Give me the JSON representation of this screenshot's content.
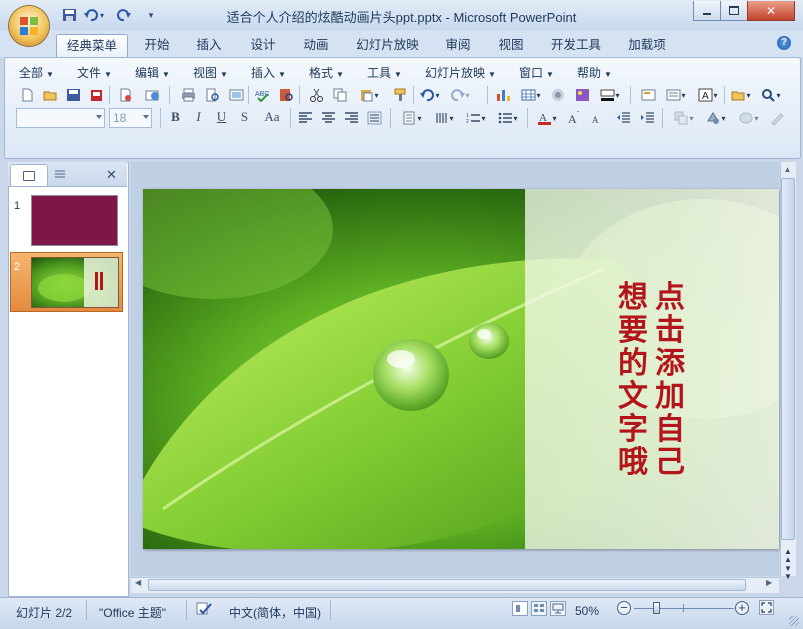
{
  "window": {
    "title": "适合个人介绍的炫酷动画片头ppt.pptx - Microsoft PowerPoint"
  },
  "qat_icons": [
    "save-icon",
    "undo-icon",
    "redo-icon",
    "customize-qat-icon"
  ],
  "tabs": [
    {
      "label": "经典菜单",
      "active": true
    },
    {
      "label": "开始"
    },
    {
      "label": "插入"
    },
    {
      "label": "设计"
    },
    {
      "label": "动画"
    },
    {
      "label": "幻灯片放映"
    },
    {
      "label": "审阅"
    },
    {
      "label": "视图"
    },
    {
      "label": "开发工具"
    },
    {
      "label": "加载项"
    }
  ],
  "menus": [
    "全部",
    "文件",
    "编辑",
    "视图",
    "插入",
    "格式",
    "工具",
    "幻灯片放映",
    "窗口",
    "帮助"
  ],
  "toolbar": {
    "font_name_value": "",
    "font_size_value": "18"
  },
  "format_buttons": [
    "B",
    "I",
    "U",
    "S",
    "Aa"
  ],
  "left_pane": {
    "slides": [
      {
        "number": "1",
        "color": "#7e1748"
      },
      {
        "number": "2"
      }
    ]
  },
  "slide": {
    "text_col1": "点击添加自己",
    "text_col2": "想要的文字哦",
    "text_color": "#b3151b"
  },
  "statusbar": {
    "slide_indicator": "幻灯片 2/2",
    "theme": "\"Office 主题\"",
    "language": "中文(简体，中国)",
    "zoom": "50%"
  },
  "colors": {
    "ribbon_bg": "#dce7f5",
    "accent_orange": "#e38a40"
  }
}
